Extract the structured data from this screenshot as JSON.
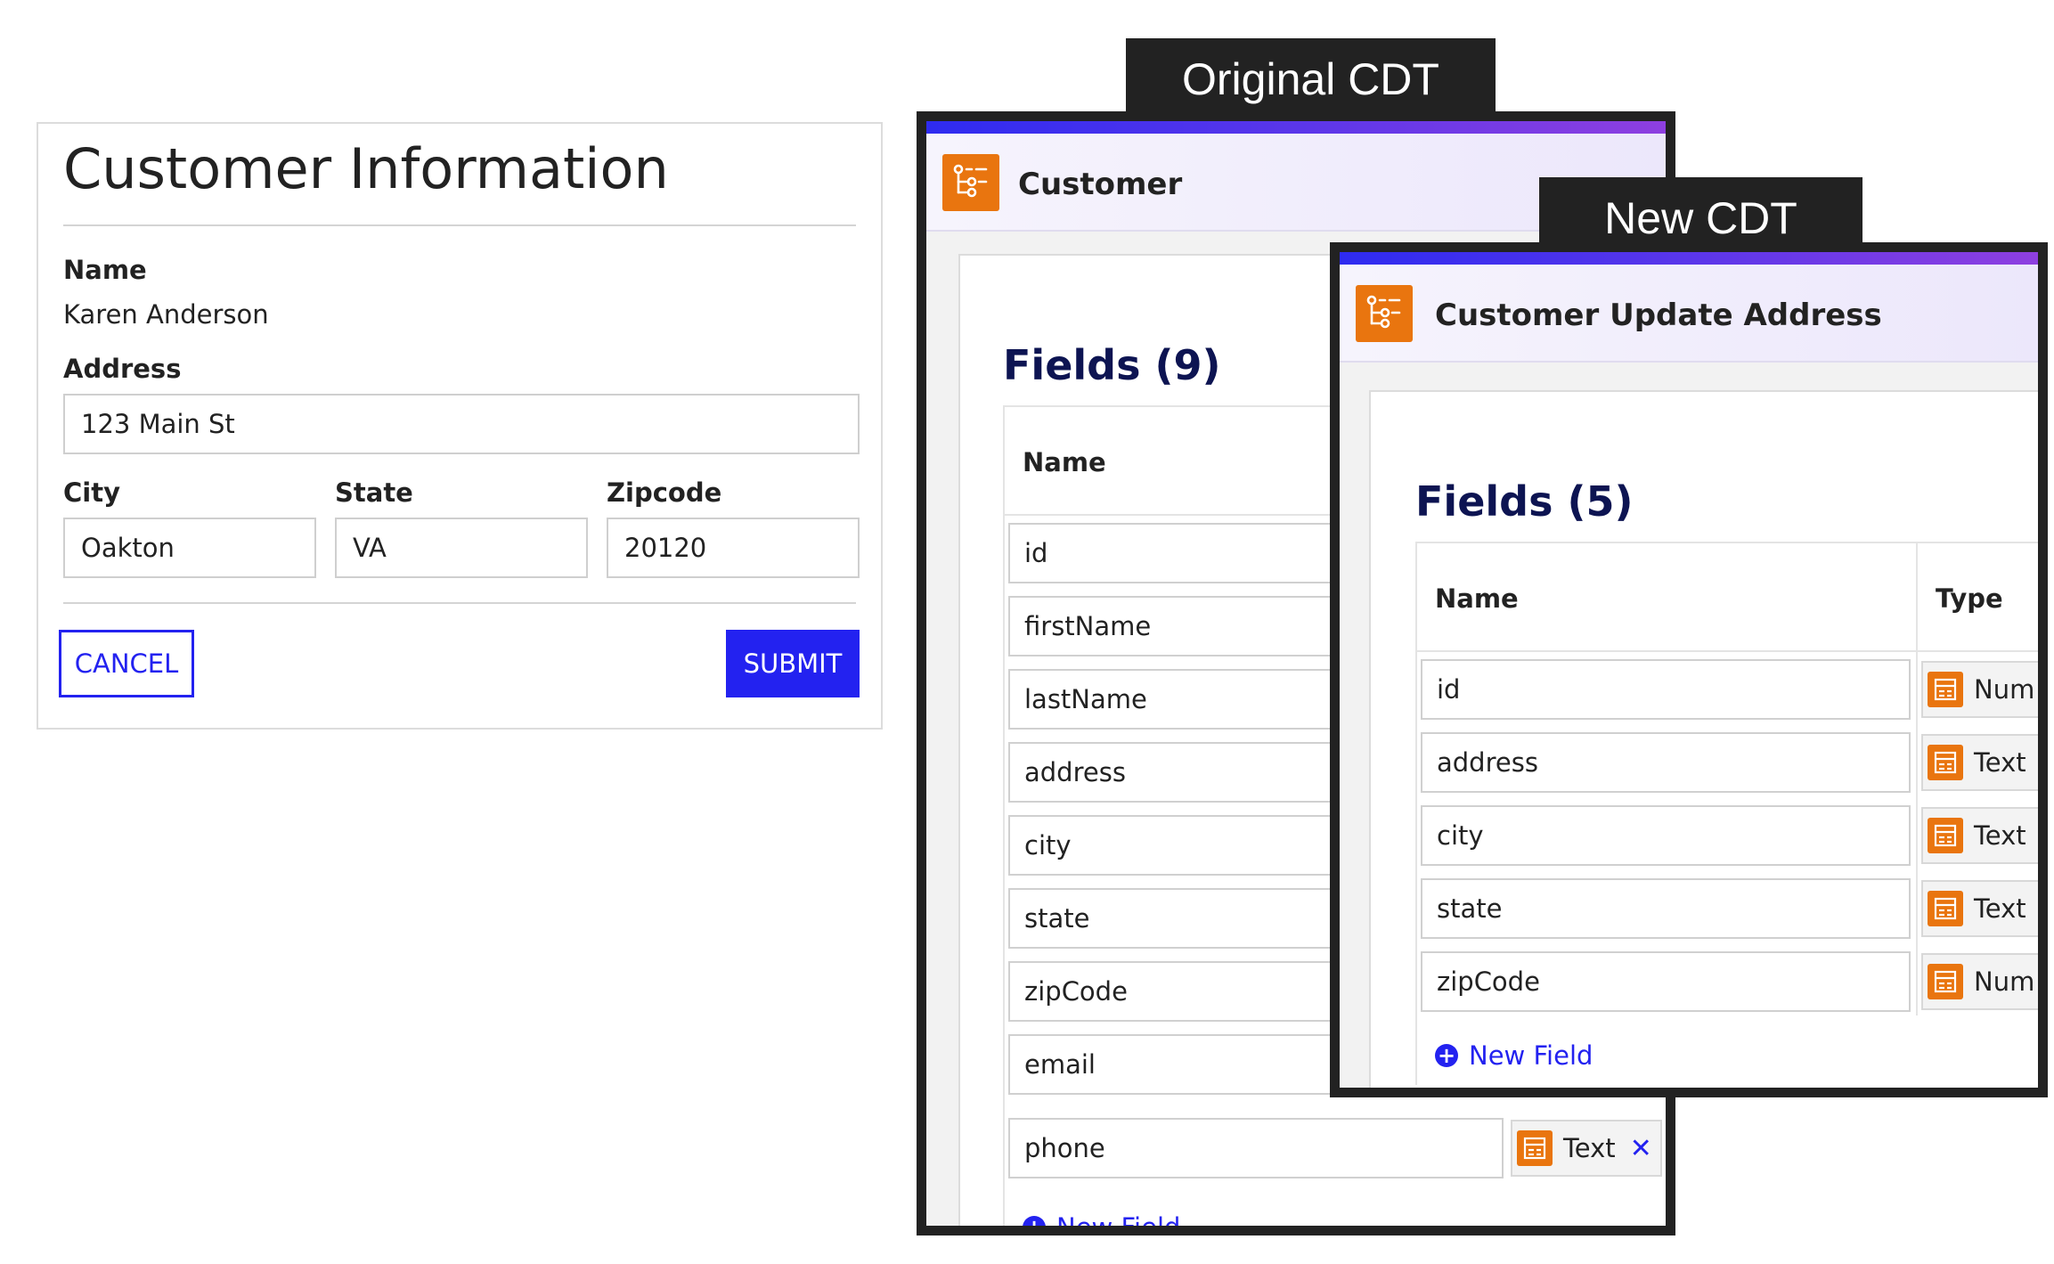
{
  "form": {
    "title": "Customer Information",
    "name_label": "Name",
    "name_value": "Karen Anderson",
    "address_label": "Address",
    "address_value": "123 Main St",
    "city_label": "City",
    "city_value": "Oakton",
    "state_label": "State",
    "state_value": "VA",
    "zip_label": "Zipcode",
    "zip_value": "20120",
    "cancel_label": "CANCEL",
    "submit_label": "SUBMIT"
  },
  "original_cdt": {
    "tab": "Original CDT",
    "title": "Customer",
    "fields_heading": "Fields (9)",
    "name_header": "Name",
    "fields": [
      "id",
      "firstName",
      "lastName",
      "address",
      "city",
      "state",
      "zipCode",
      "email",
      "phone"
    ],
    "phone_type": "Text",
    "remove_glyph": "✕",
    "new_field": "New Field"
  },
  "new_cdt": {
    "tab": "New CDT",
    "title": "Customer Update Address",
    "fields_heading": "Fields (5)",
    "name_header": "Name",
    "type_header": "Type",
    "fields": [
      {
        "name": "id",
        "type": "Num"
      },
      {
        "name": "address",
        "type": "Text"
      },
      {
        "name": "city",
        "type": "Text"
      },
      {
        "name": "state",
        "type": "Text"
      },
      {
        "name": "zipCode",
        "type": "Num"
      }
    ],
    "new_field": "New Field"
  },
  "colors": {
    "accent": "#2322f0",
    "icon_orange": "#e9750f",
    "heading_navy": "#0d1452",
    "tab_dark": "#222222"
  },
  "icons": {
    "cdt": "data-type-tree-icon",
    "field_type": "list-type-icon",
    "add": "plus-circle-icon",
    "remove": "close-icon"
  }
}
